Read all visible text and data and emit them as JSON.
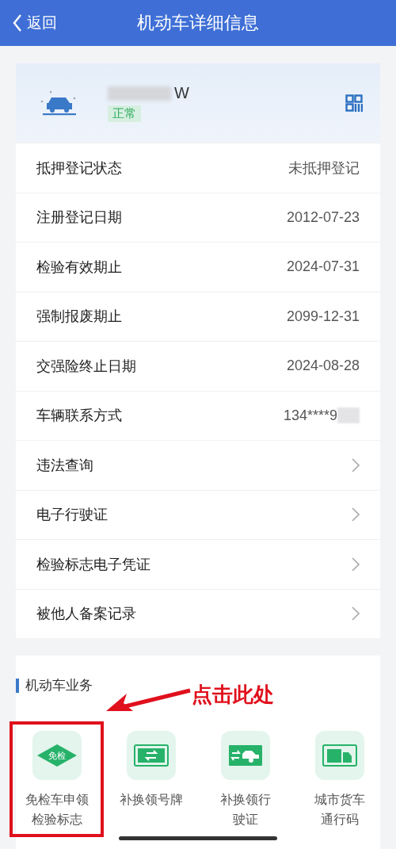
{
  "header": {
    "back": "返回",
    "title": "机动车详细信息"
  },
  "vehicle": {
    "plate": "W",
    "status": "正常"
  },
  "info_rows": [
    {
      "kind": "value",
      "label": "抵押登记状态",
      "value": "未抵押登记"
    },
    {
      "kind": "value",
      "label": "注册登记日期",
      "value": "2012-07-23"
    },
    {
      "kind": "value",
      "label": "检验有效期止",
      "value": "2024-07-31"
    },
    {
      "kind": "value",
      "label": "强制报废期止",
      "value": "2099-12-31"
    },
    {
      "kind": "value",
      "label": "交强险终止日期",
      "value": "2024-08-28"
    },
    {
      "kind": "masked",
      "label": "车辆联系方式",
      "value": "134****9"
    },
    {
      "kind": "link",
      "label": "违法查询"
    },
    {
      "kind": "link",
      "label": "电子行驶证"
    },
    {
      "kind": "link",
      "label": "检验标志电子凭证"
    },
    {
      "kind": "link",
      "label": "被他人备案记录"
    }
  ],
  "services": {
    "title": "机动车业务",
    "items": [
      {
        "kind": "badge",
        "badge_text": "免检",
        "lines": [
          "免检车申领",
          "检验标志"
        ],
        "highlighted": true
      },
      {
        "kind": "plate",
        "lines": [
          "补换领号牌"
        ],
        "highlighted": false
      },
      {
        "kind": "license",
        "lines": [
          "补换领行",
          "驶证"
        ],
        "highlighted": false
      },
      {
        "kind": "truck",
        "lines": [
          "城市货车",
          "通行码"
        ],
        "highlighted": false
      }
    ]
  },
  "annotation": {
    "text": "点击此处"
  }
}
